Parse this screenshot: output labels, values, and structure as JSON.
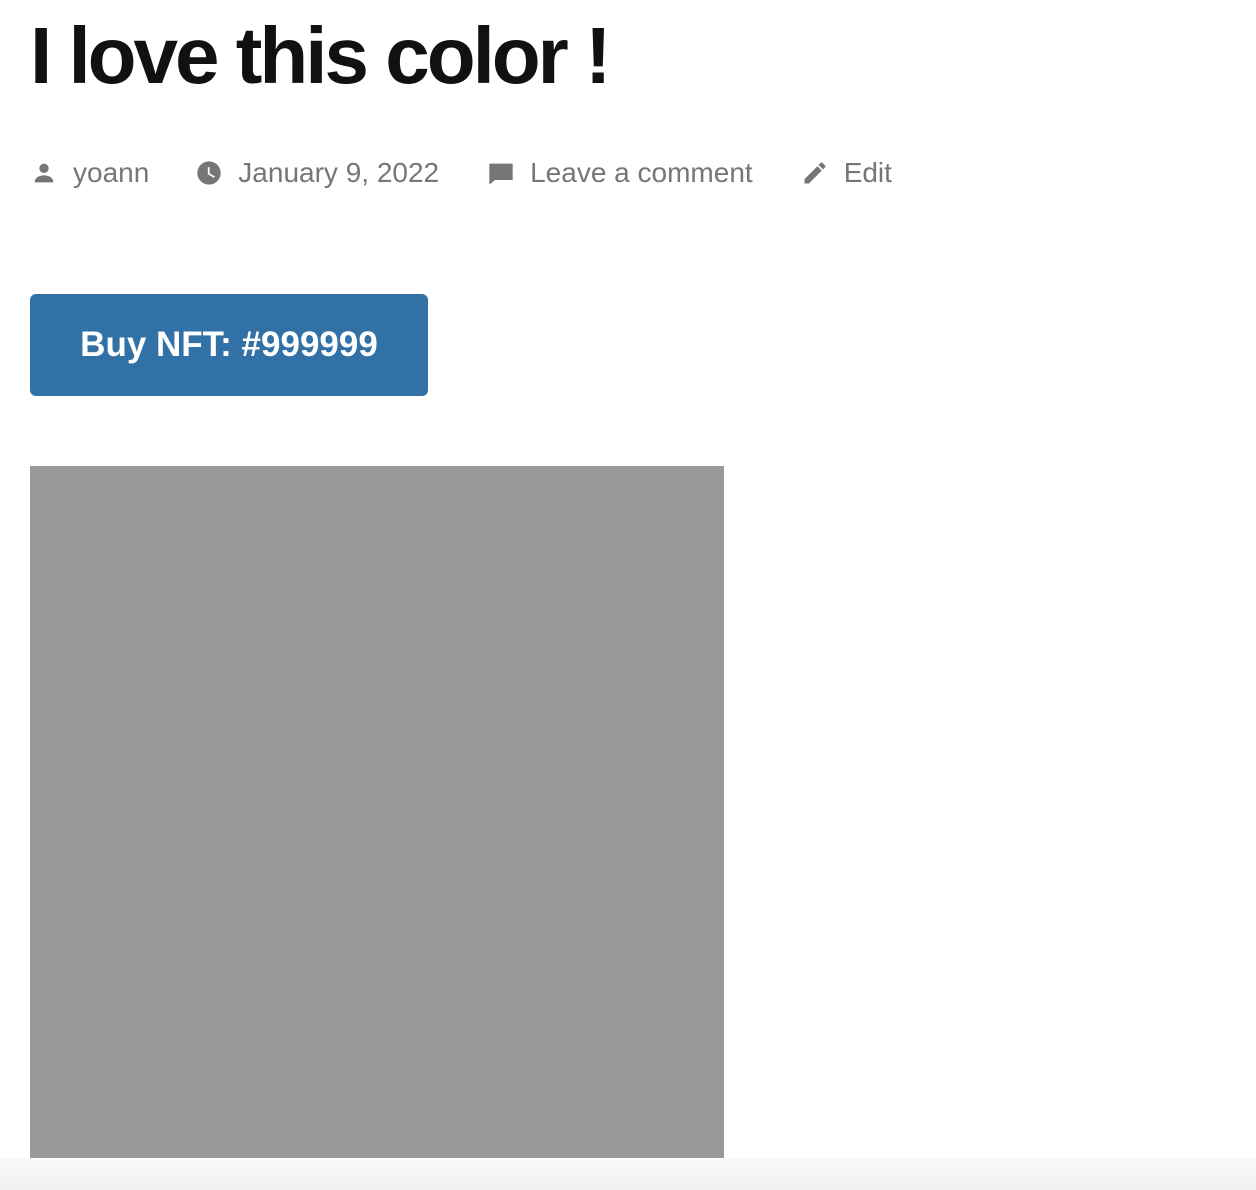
{
  "post": {
    "title": "I love this color !",
    "author": "yoann",
    "date": "January 9, 2022",
    "comments_link": "Leave a comment",
    "edit_link": "Edit"
  },
  "nft": {
    "button_label": "Buy NFT: #999999",
    "button_color": "#3271a6",
    "swatch_color": "#999999"
  },
  "icons": {
    "author": "person-icon",
    "date": "clock-icon",
    "comments": "comment-bubble-icon",
    "edit": "pencil-icon"
  }
}
